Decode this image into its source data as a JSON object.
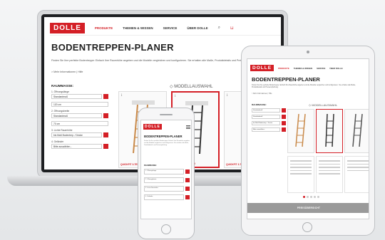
{
  "brand": {
    "logo": "DOLLE",
    "accent": "#d41f26"
  },
  "laptop": {
    "nav": [
      "PRODUKTE",
      "THEMEN & WISSEN",
      "SERVICE",
      "ÜBER DOLLE"
    ],
    "title": "BODENTREPPEN-PLANER",
    "intro": "Finden Sie Ihre perfekte Bodentreppe: Einfach Ihre Raumhöhe angeben und die Modelle vergleichen und konfigurieren. Sie erhalten alle Maße, Produktdetails und Preisempfehlung.",
    "link": "> Mehr Informationen | Hilfe",
    "sidebar_heading": "RAUMMASSE:",
    "fields": [
      {
        "label": "1. Öffnungslänge",
        "value": "Standardmaß"
      },
      {
        "label": "",
        "value": "120 cm"
      },
      {
        "label": "2. Öffnungsbreite",
        "value": "Standardmaß"
      },
      {
        "label": "",
        "value": "70 cm"
      },
      {
        "label": "3. Lichte Raumhöhe",
        "value": "bis Maß Bodentrep. / Decke"
      },
      {
        "label": "4. Geländer",
        "value": "Bitte auswählen..."
      }
    ],
    "models_heading": "MODELLAUSWAHL",
    "card_tag": "QUICKFIT 3-TEILIG"
  },
  "tablet": {
    "title": "BODENTREPPEN-PLANER",
    "sidebar_heading": "RAUMMASSE:",
    "models_heading": "MODELLAUSWAHL",
    "price_label": "PREISÜBERSICHT"
  },
  "phone": {
    "title": "BODENTREPPEN-PLANER",
    "sidebar_heading": "RAUMMASSE:",
    "fields": [
      "1. Öffnungslänge",
      "2. Öffnungsbreite",
      "3. Lichte Raumhöhe",
      "4. Geländer"
    ]
  },
  "icons": [
    "search-icon",
    "cart-icon",
    "info-icon",
    "menu-icon",
    "ladder-icon"
  ]
}
